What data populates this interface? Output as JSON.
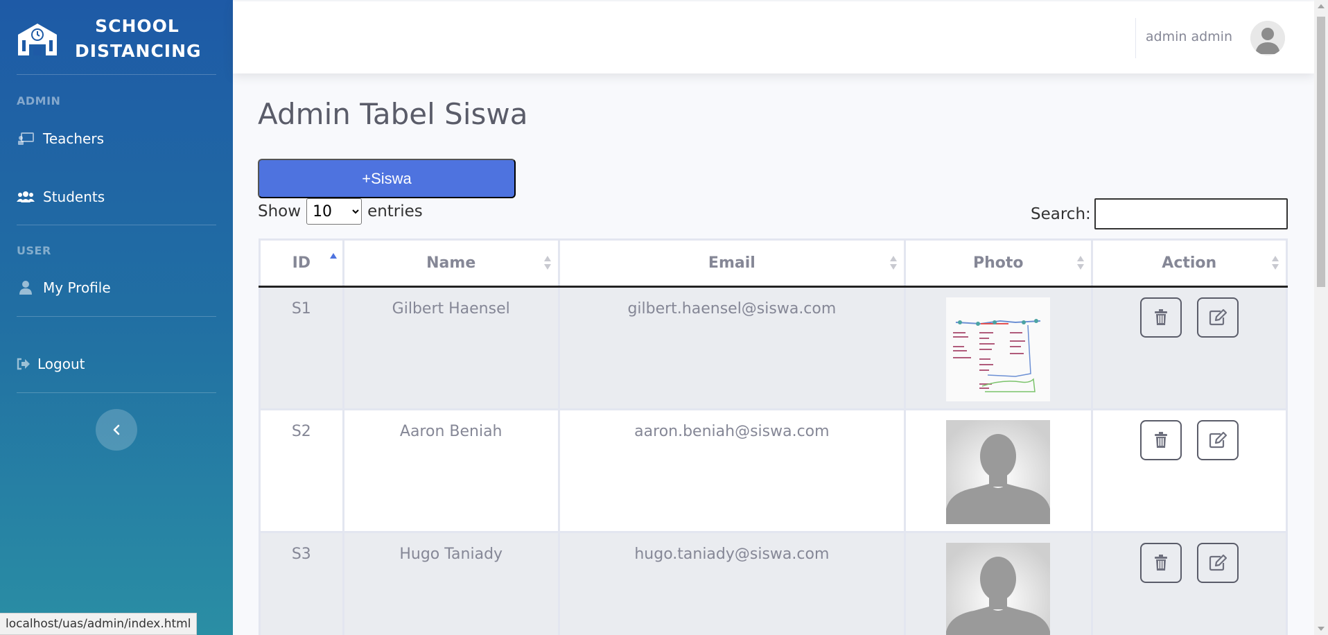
{
  "brand": {
    "line1": "SCHOOL",
    "line2": "DISTANCING",
    "icon": "school-icon"
  },
  "sidebar": {
    "admin_heading": "ADMIN",
    "user_heading": "USER",
    "items": [
      {
        "label": "Teachers",
        "icon": "chalkboard-teacher-icon"
      },
      {
        "label": "Students",
        "icon": "users-icon"
      },
      {
        "label": "My Profile",
        "icon": "user-icon"
      },
      {
        "label": "Logout",
        "icon": "sign-out-icon"
      }
    ],
    "toggle_icon": "chevron-left-icon"
  },
  "topbar": {
    "user_name": "admin admin",
    "avatar_icon": "avatar-icon"
  },
  "page": {
    "title": "Admin Tabel Siswa",
    "add_button": "+Siswa"
  },
  "table_controls": {
    "show_label": "Show",
    "entries_label": "entries",
    "page_size": "10",
    "page_size_options": [
      "10"
    ],
    "search_label": "Search:",
    "search_value": ""
  },
  "table": {
    "columns": [
      "ID",
      "Name",
      "Email",
      "Photo",
      "Action"
    ],
    "rows": [
      {
        "id": "S1",
        "name": "Gilbert Haensel",
        "email": "gilbert.haensel@siswa.com",
        "photo": "document-scan"
      },
      {
        "id": "S2",
        "name": "Aaron Beniah",
        "email": "aaron.beniah@siswa.com",
        "photo": "avatar-placeholder"
      },
      {
        "id": "S3",
        "name": "Hugo Taniady",
        "email": "hugo.taniady@siswa.com",
        "photo": "avatar-placeholder"
      }
    ],
    "delete_icon": "trash-icon",
    "edit_icon": "edit-icon"
  },
  "status_bar": {
    "url": "localhost/uas/admin/index.html"
  },
  "colors": {
    "primary": "#4e73df",
    "sidebar_top": "#1e5aa6",
    "sidebar_bottom": "#2a8ea4",
    "text_muted": "#858796"
  }
}
